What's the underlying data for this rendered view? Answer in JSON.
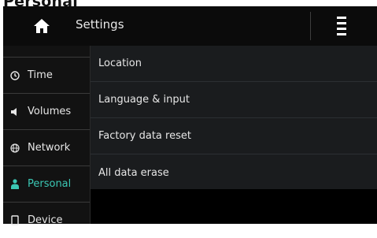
{
  "page": {
    "heading": "Personal"
  },
  "header": {
    "title": "Settings",
    "home_icon": "home-icon",
    "menu_icon": "vertical-menu-icon"
  },
  "sidebar": {
    "items": [
      {
        "label": "Time",
        "icon": "clock-icon",
        "active": false
      },
      {
        "label": "Volumes",
        "icon": "speaker-icon",
        "active": false
      },
      {
        "label": "Network",
        "icon": "globe-icon",
        "active": false
      },
      {
        "label": "Personal",
        "icon": "person-icon",
        "active": true
      },
      {
        "label": "Device",
        "icon": "device-icon",
        "active": false
      }
    ]
  },
  "main": {
    "options": [
      {
        "label": "Location"
      },
      {
        "label": "Language & input"
      },
      {
        "label": "Factory data reset"
      },
      {
        "label": "All data erase"
      }
    ]
  },
  "colors": {
    "accent": "#3bc7b4",
    "header_bg": "#0b0b0b",
    "content_bg": "#1a1c1e",
    "sidebar_bg": "#121212"
  }
}
